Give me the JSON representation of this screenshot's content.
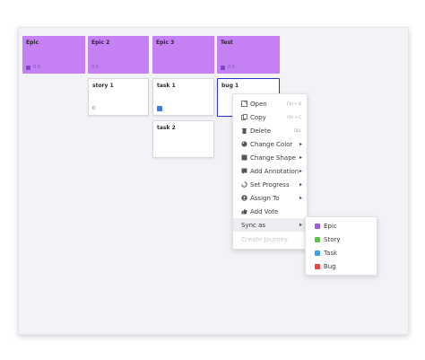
{
  "cards": [
    {
      "title": "Epic",
      "meta": "0.0"
    },
    {
      "title": "Epic 2",
      "meta": "0.0"
    },
    {
      "title": "Epic 3",
      "meta": ""
    },
    {
      "title": "Test",
      "meta": "0.0"
    },
    {
      "title": "story 1",
      "meta": "0"
    },
    {
      "title": "task 1",
      "meta": ""
    },
    {
      "title": "bug 1",
      "meta": ""
    },
    {
      "title": "task 2",
      "meta": ""
    }
  ],
  "menu": {
    "items": [
      {
        "label": "Open",
        "shortcut": "Ctrl + O",
        "icon": "open-icon"
      },
      {
        "label": "Copy",
        "shortcut": "Ctrl + C",
        "icon": "copy-icon"
      },
      {
        "label": "Delete",
        "shortcut": "DEL",
        "icon": "trash-icon"
      },
      {
        "label": "Change Color",
        "icon": "palette-icon"
      },
      {
        "label": "Change Shape",
        "icon": "shape-icon"
      },
      {
        "label": "Add Annotation",
        "icon": "annotation-icon"
      },
      {
        "label": "Set Progress",
        "icon": "progress-icon"
      },
      {
        "label": "Assign To",
        "icon": "user-icon"
      },
      {
        "label": "Add Vote",
        "icon": "thumbs-up-icon"
      },
      {
        "label": "Sync as"
      },
      {
        "label": "Create Journey"
      }
    ]
  },
  "submenu": {
    "items": [
      {
        "label": "Epic",
        "color": "#9b5de5"
      },
      {
        "label": "Story",
        "color": "#5cc24a"
      },
      {
        "label": "Task",
        "color": "#3aa0e8"
      },
      {
        "label": "Bug",
        "color": "#e8453c"
      }
    ]
  },
  "colors": {
    "epic_card": "#c580f4",
    "selection": "#2a35c9",
    "board": "#f3f3f7"
  }
}
